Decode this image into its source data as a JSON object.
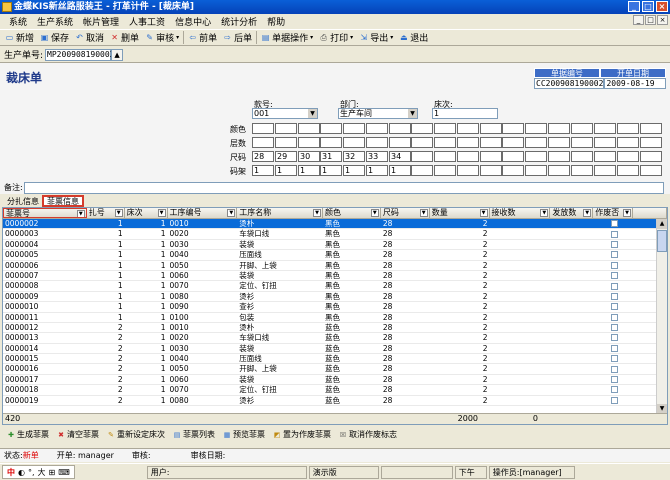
{
  "window": {
    "title": "金蝶KIS新丝路服装王 - 打革计件 - [裁床单]",
    "controls": [
      "_",
      "□",
      "×"
    ]
  },
  "menu": [
    "系统",
    "生产系统",
    "帐片管理",
    "人事工资",
    "信息中心",
    "统计分析",
    "帮助"
  ],
  "toolbar": [
    {
      "label": "新增",
      "icon": "new-doc-icon",
      "glyph": "▭"
    },
    {
      "label": "保存",
      "icon": "save-icon",
      "glyph": "▣"
    },
    {
      "label": "取消",
      "icon": "cancel-icon",
      "glyph": "↶"
    },
    {
      "label": "删单",
      "icon": "delete-icon",
      "glyph": "✕"
    },
    {
      "label": "审核",
      "icon": "approve-icon",
      "glyph": "✎",
      "dropdown": true
    },
    {
      "label": "前单",
      "icon": "prev-icon",
      "glyph": "⇦"
    },
    {
      "label": "后单",
      "icon": "next-icon",
      "glyph": "⇨"
    },
    {
      "label": "单据操作",
      "icon": "doc-ops-icon",
      "glyph": "▤",
      "dropdown": true
    },
    {
      "label": "打印",
      "icon": "print-icon",
      "glyph": "⎙",
      "dropdown": true
    },
    {
      "label": "导出",
      "icon": "export-icon",
      "glyph": "⇲",
      "dropdown": true
    },
    {
      "label": "退出",
      "icon": "exit-icon",
      "glyph": "⏏"
    }
  ],
  "docbar": {
    "label": "生产单号:",
    "value": "MP200908190003"
  },
  "form": {
    "title": "裁床单",
    "info_headers": [
      "单据编号",
      "开单日期"
    ],
    "info_values": [
      "CC200908190002",
      "2009-08-19"
    ],
    "style_label": "款号:",
    "style_value": "001",
    "dept_label": "部门:",
    "dept_value": "生产车间",
    "bed_label": "床次:",
    "bed_value": "1",
    "grid_labels": [
      "颜色",
      "层数",
      "尺码",
      "码架"
    ],
    "sizes": [
      "28",
      "29",
      "30",
      "31",
      "32",
      "33",
      "34"
    ],
    "ratios": [
      "1",
      "1",
      "1",
      "1",
      "1",
      "1",
      "1"
    ]
  },
  "remark_label": "备注:",
  "tabs": [
    "分扎信息",
    "菲票信息"
  ],
  "table": {
    "headers": [
      "菲票号",
      "扎号",
      "床次",
      "工序编号",
      "工序名称",
      "颜色",
      "尺码",
      "数量",
      "接收数",
      "发放数",
      "作废否"
    ],
    "rows": [
      [
        "0000002",
        "1",
        "1",
        "0010",
        "烫朴",
        "黑色",
        "28",
        "2"
      ],
      [
        "0000003",
        "1",
        "1",
        "0020",
        "车袋口线",
        "黑色",
        "28",
        "2"
      ],
      [
        "0000004",
        "1",
        "1",
        "0030",
        "装袋",
        "黑色",
        "28",
        "2"
      ],
      [
        "0000005",
        "1",
        "1",
        "0040",
        "压面线",
        "黑色",
        "28",
        "2"
      ],
      [
        "0000006",
        "1",
        "1",
        "0050",
        "开脚、上袋",
        "黑色",
        "28",
        "2"
      ],
      [
        "0000007",
        "1",
        "1",
        "0060",
        "装袋",
        "黑色",
        "28",
        "2"
      ],
      [
        "0000008",
        "1",
        "1",
        "0070",
        "定位、钉扭",
        "黑色",
        "28",
        "2"
      ],
      [
        "0000009",
        "1",
        "1",
        "0080",
        "烫衫",
        "黑色",
        "28",
        "2"
      ],
      [
        "0000010",
        "1",
        "1",
        "0090",
        "查衫",
        "黑色",
        "28",
        "2"
      ],
      [
        "0000011",
        "1",
        "1",
        "0100",
        "包装",
        "黑色",
        "28",
        "2"
      ],
      [
        "0000012",
        "2",
        "1",
        "0010",
        "烫朴",
        "蓝色",
        "28",
        "2"
      ],
      [
        "0000013",
        "2",
        "1",
        "0020",
        "车袋口线",
        "蓝色",
        "28",
        "2"
      ],
      [
        "0000014",
        "2",
        "1",
        "0030",
        "装袋",
        "蓝色",
        "28",
        "2"
      ],
      [
        "0000015",
        "2",
        "1",
        "0040",
        "压面线",
        "蓝色",
        "28",
        "2"
      ],
      [
        "0000016",
        "2",
        "1",
        "0050",
        "开脚、上袋",
        "蓝色",
        "28",
        "2"
      ],
      [
        "0000017",
        "2",
        "1",
        "0060",
        "装袋",
        "蓝色",
        "28",
        "2"
      ],
      [
        "0000018",
        "2",
        "1",
        "0070",
        "定位、钉扭",
        "蓝色",
        "28",
        "2"
      ],
      [
        "0000019",
        "2",
        "1",
        "0080",
        "烫衫",
        "蓝色",
        "28",
        "2"
      ]
    ],
    "footer": {
      "count": "420",
      "qty_total": "2000",
      "recv_total": "0"
    }
  },
  "actions": [
    {
      "label": "生成菲票",
      "icon": "generate-icon",
      "glyph": "✚"
    },
    {
      "label": "清空菲票",
      "icon": "clear-icon",
      "glyph": "✖"
    },
    {
      "label": "重新设定床次",
      "icon": "reset-icon",
      "glyph": "✎"
    },
    {
      "label": "菲票列表",
      "icon": "list-icon",
      "glyph": "▤"
    },
    {
      "label": "预览菲票",
      "icon": "preview-icon",
      "glyph": "▦"
    },
    {
      "label": "置为作废菲票",
      "icon": "void-icon",
      "glyph": "◩"
    },
    {
      "label": "取消作废标志",
      "icon": "unvoid-icon",
      "glyph": "☒"
    }
  ],
  "status": {
    "state_label": "状态:",
    "state_value": "新单",
    "opener_label": "开单:",
    "opener_value": "manager",
    "reviewer_label": "审核:",
    "review_date_label": "审核日期:"
  },
  "taskbar": {
    "ime": [
      "中",
      "◐",
      "°,",
      "大",
      "⊞",
      "⌨"
    ],
    "user_label": "用户:",
    "demo": "演示版",
    "time": "下午 04:",
    "operator": "操作员:[manager]"
  },
  "colors": {
    "title_bg": "#0542b8",
    "selected_row": "#0a6bd8",
    "highlight_border": "#d43c2c",
    "status_red": "#dd0000"
  }
}
